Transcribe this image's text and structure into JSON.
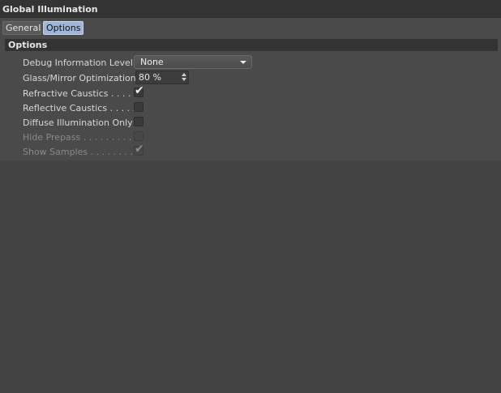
{
  "window": {
    "title": "Global Illumination"
  },
  "tabs": [
    {
      "label": "General",
      "active": false
    },
    {
      "label": "Options",
      "active": true
    }
  ],
  "group": {
    "title": "Options"
  },
  "fields": {
    "debug_level": {
      "label": "Debug Information Level",
      "value": "None"
    },
    "glass_mirror": {
      "label": "Glass/Mirror Optimization",
      "value": "80 %"
    },
    "refractive_caustics": {
      "label": "Refractive Caustics . . . . . .",
      "checked": true,
      "enabled": true
    },
    "reflective_caustics": {
      "label": "Reflective Caustics . . . . . .",
      "checked": false,
      "enabled": true
    },
    "diffuse_only": {
      "label": "Diffuse Illumination Only",
      "checked": false,
      "enabled": true
    },
    "hide_prepass": {
      "label": "Hide Prepass . . . . . . . . . . .",
      "checked": false,
      "enabled": false
    },
    "show_samples": {
      "label": "Show Samples . . . . . . . . . .",
      "checked": true,
      "enabled": false
    }
  },
  "colors": {
    "background": "#434343",
    "panel": "#4a4a4a",
    "header": "#333333",
    "active_tab": "#9fb6d8"
  },
  "icons": {
    "dropdown": "chevron-down-icon",
    "spinner": "spinner-arrows-icon",
    "check": "checkmark-icon"
  }
}
